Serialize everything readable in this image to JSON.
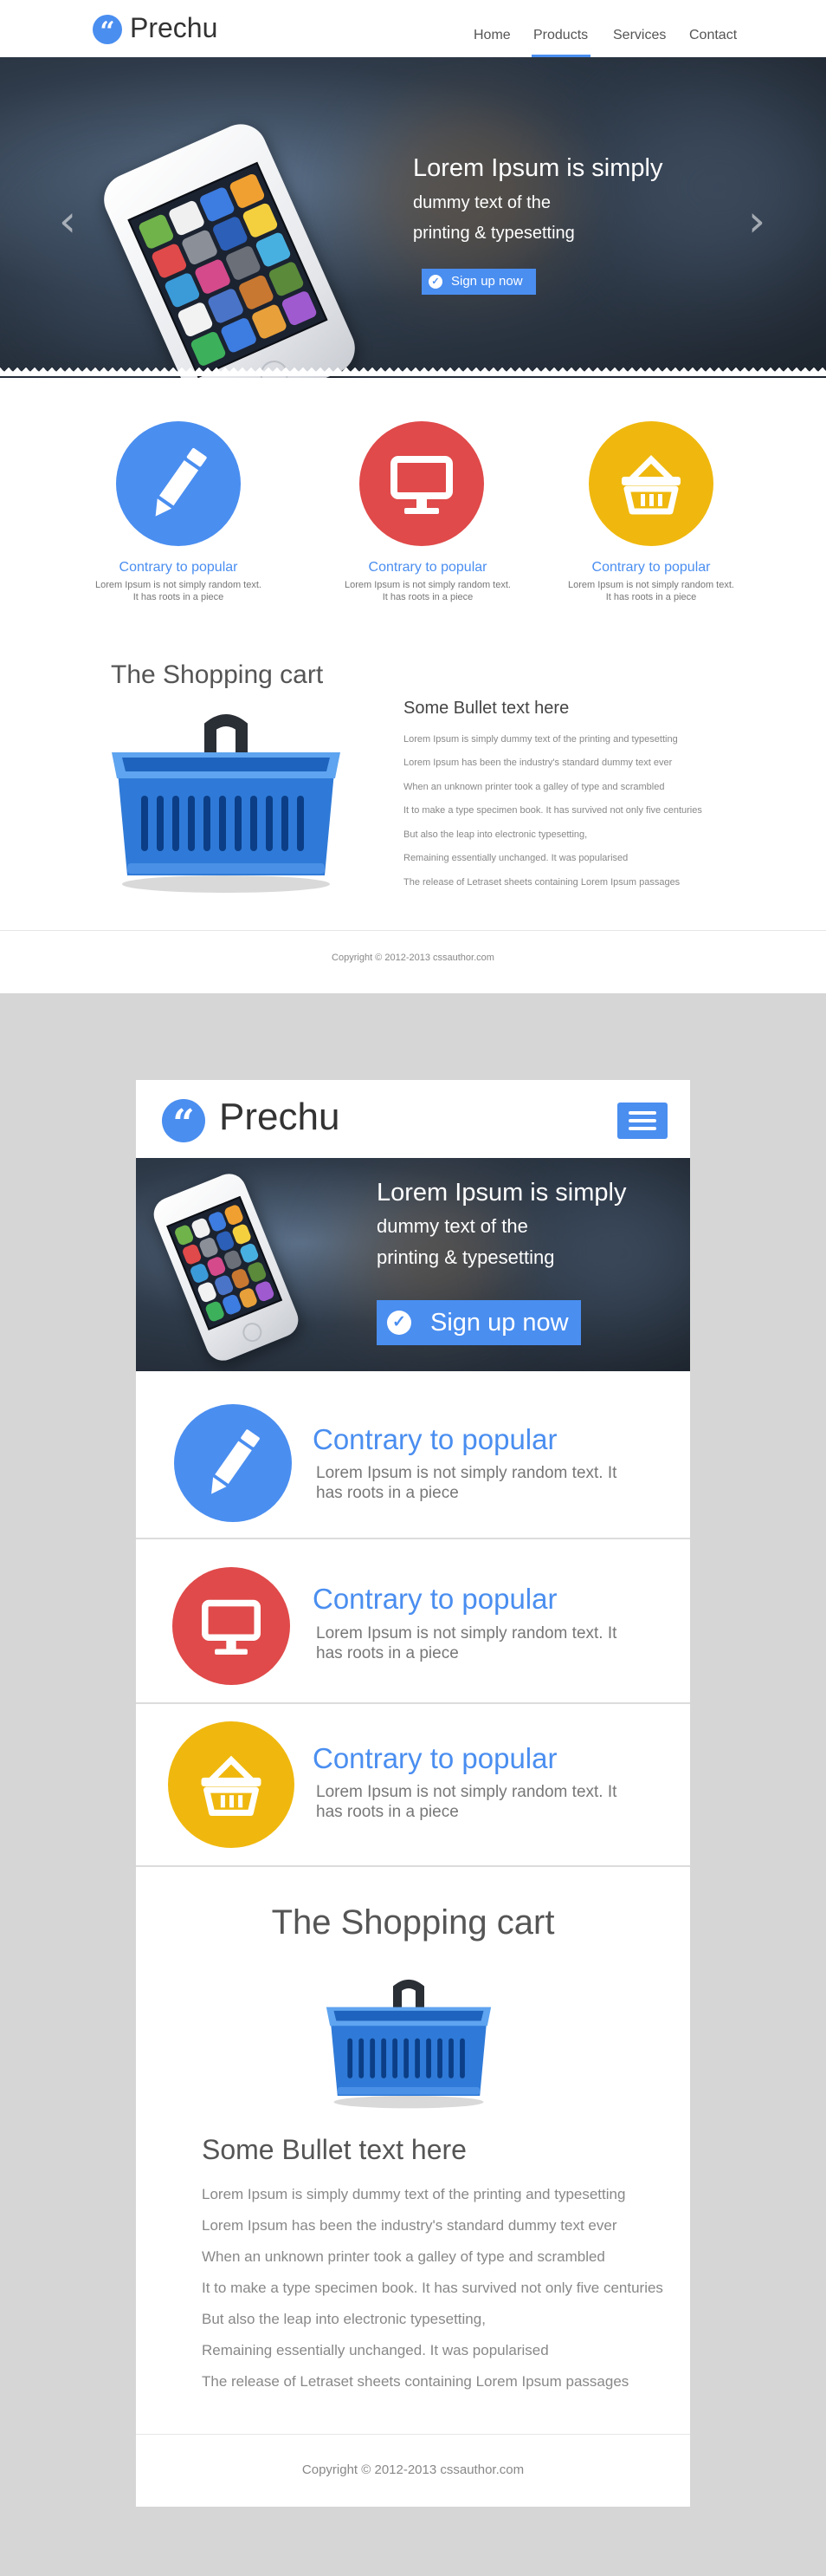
{
  "brand": {
    "name": "Prechu",
    "logo_glyph": "“"
  },
  "nav": {
    "home": "Home",
    "products": "Products",
    "services": "Services",
    "contact": "Contact",
    "active": "Products"
  },
  "hero": {
    "title": "Lorem Ipsum is simply",
    "line2": "dummy text of the",
    "line3": "printing & typesetting",
    "signup_label": "Sign up now",
    "check_glyph": "✓",
    "arrow_left": "‹",
    "arrow_right": "›"
  },
  "features": [
    {
      "title": "Contrary to popular",
      "text_desktop_1": "Lorem Ipsum is not simply random text.",
      "text_desktop_2": "It has roots in a piece",
      "text_mobile_1": "Lorem Ipsum is not simply random text. It",
      "text_mobile_2": "has roots in a piece",
      "icon": "pencil-icon",
      "color": "#4a8ef0"
    },
    {
      "title": "Contrary to popular",
      "text_desktop_1": "Lorem Ipsum is not simply random text.",
      "text_desktop_2": "It has roots in a piece",
      "text_mobile_1": "Lorem Ipsum is not simply random text. It",
      "text_mobile_2": "has roots in a piece",
      "icon": "monitor-icon",
      "color": "#e04a4a"
    },
    {
      "title": "Contrary to popular",
      "text_desktop_1": "Lorem Ipsum is not simply random text.",
      "text_desktop_2": "It has roots in a piece",
      "text_mobile_1": "Lorem Ipsum is not simply random text. It",
      "text_mobile_2": "has roots in a piece",
      "icon": "basket-icon",
      "color": "#f0b80e"
    }
  ],
  "cart": {
    "title": "The Shopping cart",
    "bullet_heading": "Some Bullet text here",
    "bullets": [
      "Lorem Ipsum is simply dummy text of the printing and typesetting",
      "Lorem Ipsum has been the industry's standard dummy text ever",
      "When an unknown printer took a galley of type and scrambled",
      "It to make a type specimen book. It has survived not only five centuries",
      "But also the leap into electronic typesetting,",
      "Remaining essentially unchanged. It was popularised",
      "The release of Letraset sheets containing Lorem Ipsum passages"
    ]
  },
  "footer": {
    "copyright": "Copyright © 2012-2013 cssauthor.com"
  },
  "colors": {
    "accent": "#4a8ef0",
    "red": "#e04a4a",
    "yellow": "#f0b80e",
    "band": "#d6d6d6"
  }
}
